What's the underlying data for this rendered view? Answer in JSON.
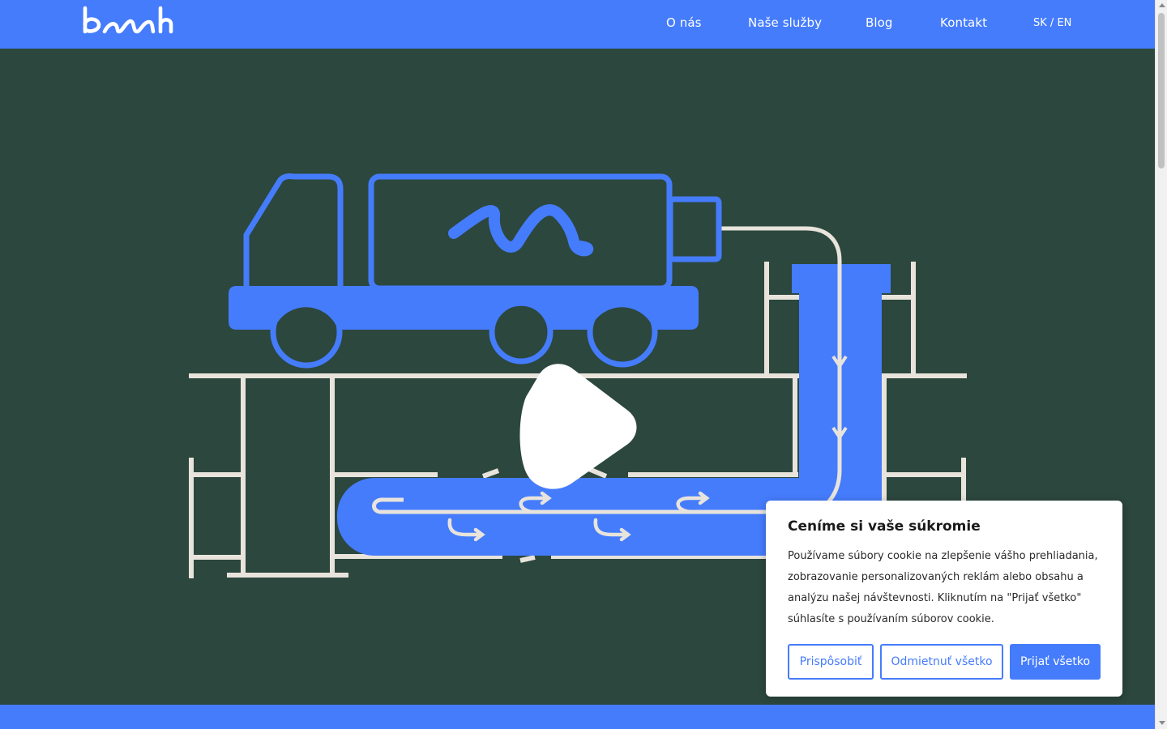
{
  "header": {
    "logo_text": "bnh",
    "nav": [
      "O nás",
      "Naše služby",
      "Blog",
      "Kontakt"
    ],
    "lang": {
      "sk": "SK",
      "separator": "/",
      "en": "EN"
    }
  },
  "hero": {
    "play_icon": "play-icon"
  },
  "cookie_banner": {
    "title": "Ceníme si vaše súkromie",
    "text": "Používame súbory cookie na zlepšenie vášho prehliadania, zobrazovanie personalizovaných reklám alebo obsahu a analýzu našej návštevnosti. Kliknutím na \"Prijať všetko\" súhlasíte s používaním súborov cookie.",
    "customize_label": "Prispôsobiť",
    "reject_label": "Odmietnuť všetko",
    "accept_label": "Prijať všetko"
  },
  "colors": {
    "brand_blue": "#457cfc",
    "hero_bg": "#2c473e",
    "pipe": "#e8e4dc"
  }
}
